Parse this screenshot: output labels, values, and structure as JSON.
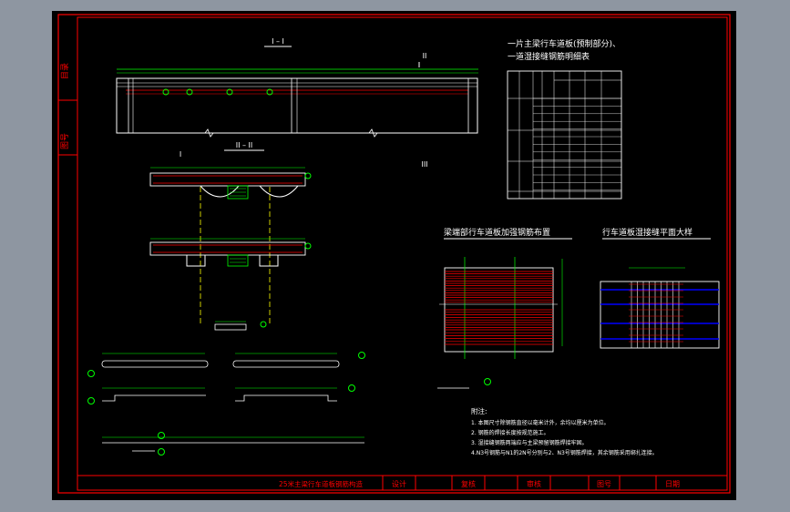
{
  "sheet": {
    "left_strip": {
      "label_top": "目录",
      "label_bottom": "图号"
    },
    "titles": {
      "section_1_1": "I – I",
      "section_2_2": "II – II",
      "mark_2": "II",
      "mark_1": "I",
      "mark_3": "III",
      "table_title_line1": "一片主梁行车道板(预制部分)、",
      "table_title_line2": "一道湿接缝钢筋明细表",
      "plan_left": "梁端部行车道板加强钢筋布置",
      "plan_right": "行车道板湿接缝平面大样"
    },
    "notes": {
      "heading": "附注:",
      "lines": [
        "1. 本图尺寸除钢筋直径以毫米计外，余均以厘米为单位。",
        "2. 钢筋的焊接长度按规范施工。",
        "3. 湿接缝钢筋两端应与主梁预留钢筋焊接牢固。",
        "4.N3号钢筋与N1的2N号分别与2、N3号钢筋焊接，其余钢筋采用绑扎连接。"
      ]
    },
    "title_block": {
      "drawing_name": "25米主梁行车道板钢筋构造",
      "design_label": "设计",
      "review_label": "复核",
      "approve_label": "审核",
      "drawing_no_label": "图号",
      "date_label": "日期"
    },
    "colors": {
      "background": "#000000",
      "frame": "#ff0000",
      "concrete": "#ffffff",
      "rebar": "#ff0000",
      "dimension": "#00ff00",
      "axis": "#ffff00",
      "titles": "#ffffff",
      "title_block_text": "#ff0000",
      "plan_bar": "#0000ff"
    }
  }
}
